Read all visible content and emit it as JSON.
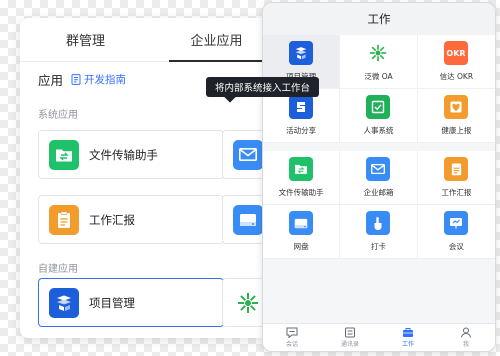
{
  "admin": {
    "tabs": [
      {
        "label": "群管理",
        "active": false
      },
      {
        "label": "企业应用",
        "active": true
      }
    ],
    "section_title": "应用",
    "dev_guide_link": "开发指南",
    "system_apps_label": "系统应用",
    "custom_apps_label": "自建应用",
    "system_apps": [
      {
        "label": "文件传输助手",
        "icon": "file-transfer-icon",
        "color": "#1fc16b"
      },
      {
        "label": "",
        "icon": "mail-icon",
        "color": "#3a8cf5"
      },
      {
        "label": "工作汇报",
        "icon": "report-icon",
        "color": "#f39c2e"
      },
      {
        "label": "",
        "icon": "drive-icon",
        "color": "#3a8cf5"
      }
    ],
    "custom_apps": [
      {
        "label": "项目管理",
        "icon": "project-icon",
        "color": "#1d5edb",
        "selected": true
      },
      {
        "label": "",
        "icon": "fanwei-oa-icon",
        "color": "#ffffff"
      }
    ]
  },
  "tooltip": {
    "text": "将内部系统接入工作台"
  },
  "mobile": {
    "title": "工作",
    "apps_group1": [
      {
        "label": "项目管理",
        "icon": "project-icon",
        "color": "#1d5edb",
        "highlighted": true
      },
      {
        "label": "泛微 OA",
        "icon": "fanwei-oa-icon",
        "color": "#ffffff"
      },
      {
        "label": "信达 OKR",
        "icon": "okr-icon",
        "color": "#ff6a3d"
      },
      {
        "label": "活动分享",
        "icon": "activity-share-icon",
        "color": "#1d5edb"
      },
      {
        "label": "人事系统",
        "icon": "hr-icon",
        "color": "#1fb15a"
      },
      {
        "label": "健康上报",
        "icon": "health-icon",
        "color": "#f39c2e"
      }
    ],
    "apps_group2": [
      {
        "label": "文件传输助手",
        "icon": "file-transfer-icon",
        "color": "#1fc16b"
      },
      {
        "label": "企业邮箱",
        "icon": "mail-icon",
        "color": "#3a8cf5"
      },
      {
        "label": "工作汇报",
        "icon": "report-icon",
        "color": "#f39c2e"
      },
      {
        "label": "网盘",
        "icon": "drive-icon",
        "color": "#3a8cf5"
      },
      {
        "label": "打卡",
        "icon": "clock-in-icon",
        "color": "#3a8cf5"
      },
      {
        "label": "会议",
        "icon": "meeting-icon",
        "color": "#3a8cf5"
      }
    ],
    "tabbar": [
      {
        "label": "会话",
        "icon": "chat-icon",
        "active": false
      },
      {
        "label": "通讯录",
        "icon": "contacts-icon",
        "active": false
      },
      {
        "label": "工作",
        "icon": "work-icon",
        "active": true
      },
      {
        "label": "我",
        "icon": "profile-icon",
        "active": false
      }
    ]
  }
}
